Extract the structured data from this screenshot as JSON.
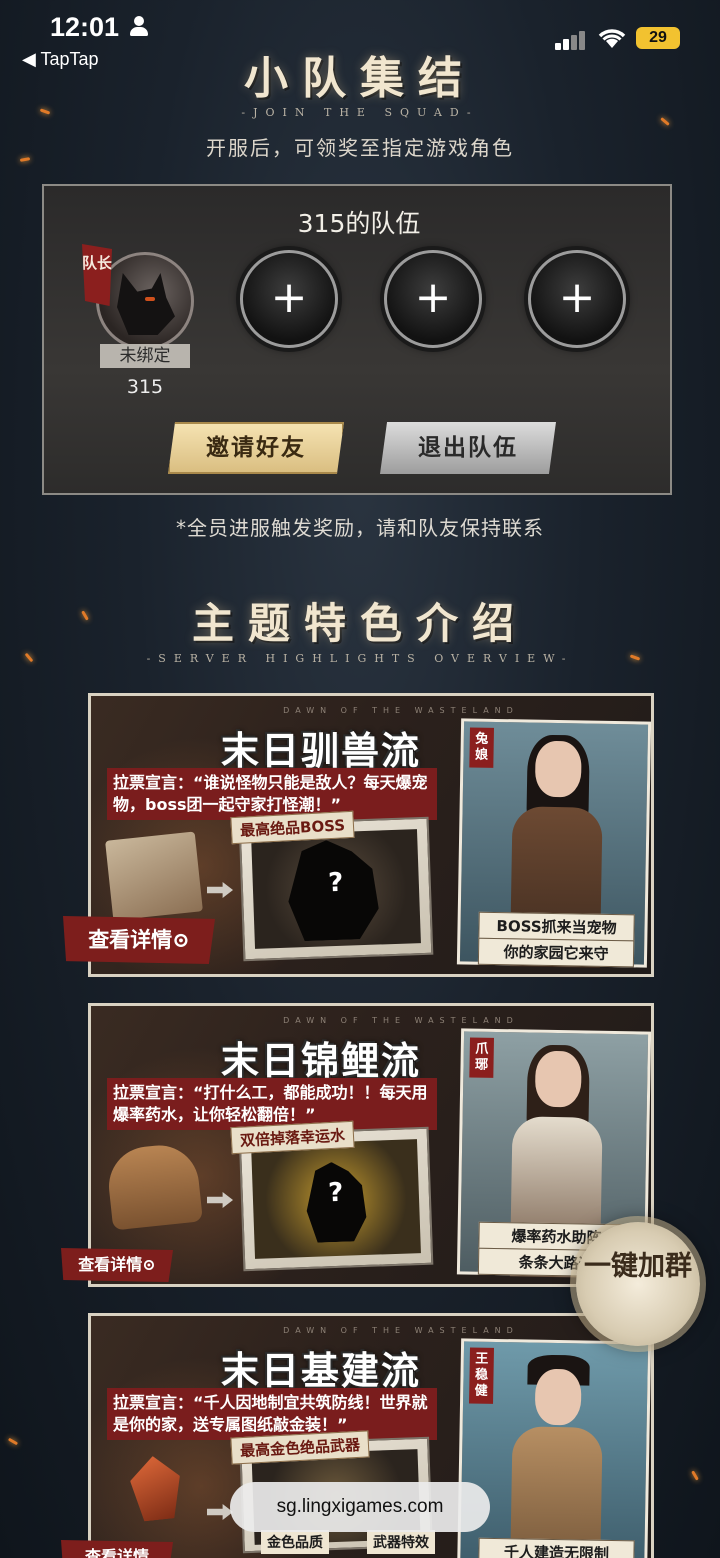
{
  "status_bar": {
    "time": "12:01",
    "back_label": "◀ TapTap",
    "battery": "29"
  },
  "squad_section": {
    "title": "小队集结",
    "subtitle_en": "-JOIN THE SQUAD-",
    "description": "开服后，可领奖至指定游戏角色",
    "team_name": "315的队伍",
    "leader": {
      "badge": "队长",
      "status": "未绑定",
      "id": "315"
    },
    "empty_slot_symbol": "+",
    "invite_button": "邀请好友",
    "quit_button": "退出队伍",
    "notice": "*全员进服触发奖励，请和队友保持联系"
  },
  "highlights": {
    "title": "主题特色介绍",
    "subtitle_en": "-SERVER HIGHLIGHTS OVERVIEW-",
    "cards": [
      {
        "tiny": "DAWN OF THE WASTELAND",
        "title": "末日驯兽流",
        "slogan": "拉票宣言：“谁说怪物只能是敌人？每天爆宠物，boss团一起守家打怪潮！”",
        "reward_label": "最高绝品BOSS",
        "mystery": "?",
        "host": "兔娘",
        "caption_1": "BOSS抓来当宠物",
        "caption_2": "你的家园它来守",
        "detail": "查看详情⊙"
      },
      {
        "tiny": "DAWN OF THE WASTELAND",
        "title": "末日锦鲤流",
        "slogan": "拉票宣言：“打什么工，都能成功！！每天用爆率药水，让你轻松翻倍！”",
        "reward_label": "双倍掉落幸运水",
        "mystery": "?",
        "host": "爪琊",
        "caption_1": "爆率药水助阵",
        "caption_2": "条条大路通",
        "detail": "查看详情⊙"
      },
      {
        "tiny": "DAWN OF THE WASTELAND",
        "title": "末日基建流",
        "slogan": "拉票宣言：“千人因地制宜共筑防线！世界就是你的家，送专属图纸敲金装！”",
        "reward_label": "最高金色绝品武器",
        "mystery": "",
        "host": "王稳健",
        "caption_1": "千人建造无限制",
        "caption_2": "",
        "detail": "查看详情",
        "extra_1": "金色品质",
        "extra_2": "武器特效"
      }
    ]
  },
  "join_group": "一键加群",
  "url": "sg.lingxigames.com"
}
